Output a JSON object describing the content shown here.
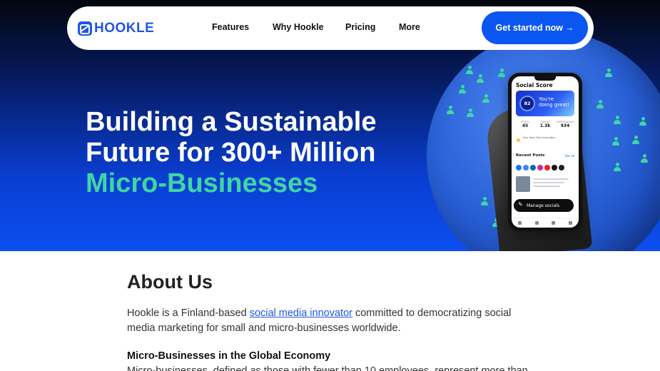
{
  "brand": {
    "name": "HOOKLE",
    "color": "#1f55e6",
    "accent": "#3fd6a3"
  },
  "nav": {
    "links": [
      "Features",
      "Why Hookle",
      "Pricing",
      "More"
    ],
    "cta_label": "Get started now",
    "cta_icon": "arrow-right-icon"
  },
  "hero": {
    "title_line1": "Building a Sustainable",
    "title_line2": "Future for 300+ Million",
    "title_accent": "Micro-Businesses"
  },
  "phone": {
    "title": "Social Score",
    "score": "82",
    "message_line1": "You're",
    "message_line2": "doing great!",
    "stats": [
      {
        "label": "POSTS",
        "value": "45"
      },
      {
        "label": "REACH",
        "value": "1.3k"
      },
      {
        "label": "IMPRESSIONS",
        "value": "934"
      }
    ],
    "tip": "Your Daily Post Inspiration",
    "recent_posts": "Recent Posts",
    "see_all": "See all",
    "manage": "Manage socials"
  },
  "about": {
    "heading": "About Us",
    "intro_before": "Hookle is a Finland-based ",
    "intro_link": "social media innovator",
    "intro_after": " committed to democratizing social media marketing for small and micro-businesses worldwide.",
    "subheading": "Micro-Businesses in the Global Economy",
    "body_partial": "Micro-businesses, defined as those with fewer than 10 employees, represent more than"
  }
}
